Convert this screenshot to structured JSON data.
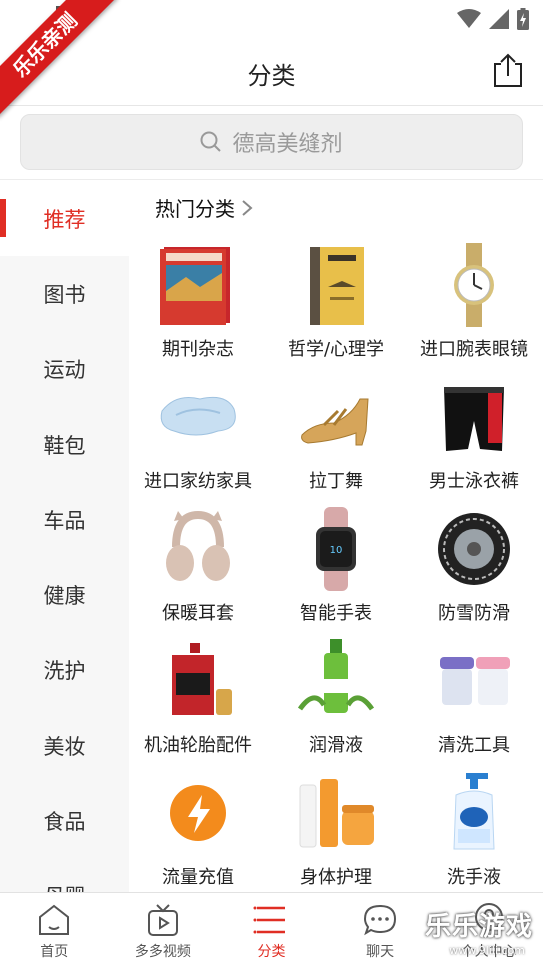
{
  "watermark": {
    "ribbon_text": "乐乐亲测",
    "corner_text": "乐乐游戏",
    "corner_url": "www.9lili.com"
  },
  "header": {
    "title": "分类",
    "share_icon": "share-icon"
  },
  "search": {
    "placeholder": "德高美缝剂"
  },
  "sidebar": {
    "items": [
      {
        "label": "推荐",
        "active": true
      },
      {
        "label": "图书"
      },
      {
        "label": "运动"
      },
      {
        "label": "鞋包"
      },
      {
        "label": "车品"
      },
      {
        "label": "健康"
      },
      {
        "label": "洗护"
      },
      {
        "label": "美妆"
      },
      {
        "label": "食品"
      },
      {
        "label": "母婴"
      }
    ]
  },
  "main": {
    "section_title": "热门分类",
    "categories": [
      {
        "label": "期刊杂志",
        "icon": "magazine-icon"
      },
      {
        "label": "哲学/心理学",
        "icon": "book-icon"
      },
      {
        "label": "进口腕表眼镜",
        "icon": "watch-icon"
      },
      {
        "label": "进口家纺家具",
        "icon": "pillow-icon"
      },
      {
        "label": "拉丁舞",
        "icon": "dance-shoe-icon"
      },
      {
        "label": "男士泳衣裤",
        "icon": "swim-trunks-icon"
      },
      {
        "label": "保暖耳套",
        "icon": "earmuffs-icon"
      },
      {
        "label": "智能手表",
        "icon": "smartwatch-icon"
      },
      {
        "label": "防雪防滑",
        "icon": "snow-chain-icon"
      },
      {
        "label": "机油轮胎配件",
        "icon": "engine-oil-icon"
      },
      {
        "label": "润滑液",
        "icon": "lubricant-bottle-icon"
      },
      {
        "label": "清洗工具",
        "icon": "lens-case-icon"
      },
      {
        "label": "流量充值",
        "icon": "lightning-icon"
      },
      {
        "label": "身体护理",
        "icon": "body-care-icon"
      },
      {
        "label": "洗手液",
        "icon": "handwash-icon"
      }
    ]
  },
  "bottom_nav": {
    "items": [
      {
        "label": "首页",
        "icon": "home-icon"
      },
      {
        "label": "多多视频",
        "icon": "video-icon"
      },
      {
        "label": "分类",
        "icon": "category-list-icon",
        "active": true
      },
      {
        "label": "聊天",
        "icon": "chat-icon"
      },
      {
        "label": "个人中心",
        "icon": "person-icon"
      }
    ]
  },
  "colors": {
    "accent": "#e02e24",
    "sidebar_bg": "#f7f7f7",
    "search_bg": "#eeeeee"
  }
}
